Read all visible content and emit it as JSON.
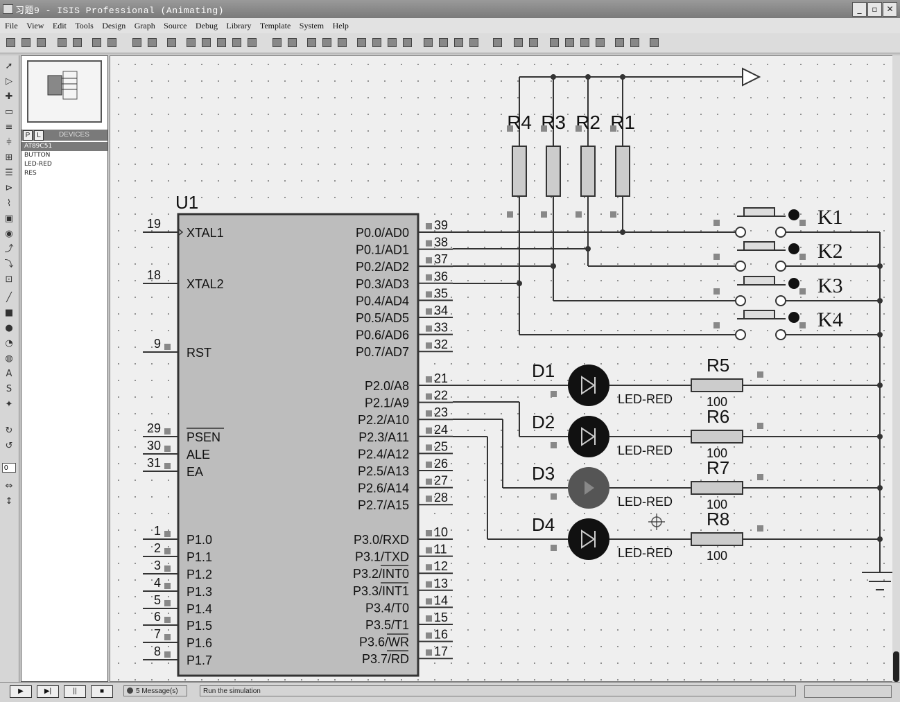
{
  "window": {
    "title": "习题9 - ISIS Professional (Animating)"
  },
  "menu": [
    "File",
    "View",
    "Edit",
    "Tools",
    "Design",
    "Graph",
    "Source",
    "Debug",
    "Library",
    "Template",
    "System",
    "Help"
  ],
  "devices": {
    "tabs": [
      "P",
      "L"
    ],
    "header": "DEVICES",
    "items": [
      "AT89C51",
      "BUTTON",
      "LED-RED",
      "RES"
    ],
    "selected": "AT89C51"
  },
  "rotation_value": "0",
  "schematic": {
    "chip": {
      "ref": "U1",
      "left_pins": [
        {
          "num": "19",
          "name": "XTAL1"
        },
        {
          "num": "18",
          "name": "XTAL2"
        },
        {
          "num": "9",
          "name": "RST"
        },
        {
          "num": "29",
          "name": "PSEN"
        },
        {
          "num": "30",
          "name": "ALE"
        },
        {
          "num": "31",
          "name": "EA"
        },
        {
          "num": "1",
          "name": "P1.0"
        },
        {
          "num": "2",
          "name": "P1.1"
        },
        {
          "num": "3",
          "name": "P1.2"
        },
        {
          "num": "4",
          "name": "P1.3"
        },
        {
          "num": "5",
          "name": "P1.4"
        },
        {
          "num": "6",
          "name": "P1.5"
        },
        {
          "num": "7",
          "name": "P1.6"
        },
        {
          "num": "8",
          "name": "P1.7"
        }
      ],
      "right_pins": [
        {
          "num": "39",
          "name": "P0.0/AD0"
        },
        {
          "num": "38",
          "name": "P0.1/AD1"
        },
        {
          "num": "37",
          "name": "P0.2/AD2"
        },
        {
          "num": "36",
          "name": "P0.3/AD3"
        },
        {
          "num": "35",
          "name": "P0.4/AD4"
        },
        {
          "num": "34",
          "name": "P0.5/AD5"
        },
        {
          "num": "33",
          "name": "P0.6/AD6"
        },
        {
          "num": "32",
          "name": "P0.7/AD7"
        },
        {
          "num": "21",
          "name": "P2.0/A8"
        },
        {
          "num": "22",
          "name": "P2.1/A9"
        },
        {
          "num": "23",
          "name": "P2.2/A10"
        },
        {
          "num": "24",
          "name": "P2.3/A11"
        },
        {
          "num": "25",
          "name": "P2.4/A12"
        },
        {
          "num": "26",
          "name": "P2.5/A13"
        },
        {
          "num": "27",
          "name": "P2.6/A14"
        },
        {
          "num": "28",
          "name": "P2.7/A15"
        },
        {
          "num": "10",
          "name": "P3.0/RXD"
        },
        {
          "num": "11",
          "name": "P3.1/TXD"
        },
        {
          "num": "12",
          "name": "P3.2/INT0"
        },
        {
          "num": "13",
          "name": "P3.3/INT1"
        },
        {
          "num": "14",
          "name": "P3.4/T0"
        },
        {
          "num": "15",
          "name": "P3.5/T1"
        },
        {
          "num": "16",
          "name": "P3.6/WR"
        },
        {
          "num": "17",
          "name": "P3.7/RD"
        }
      ]
    },
    "pullups": [
      "R4",
      "R3",
      "R2",
      "R1"
    ],
    "buttons": [
      "K1",
      "K2",
      "K3",
      "K4"
    ],
    "leds": [
      {
        "ref": "D1",
        "type": "LED-RED",
        "lit": false
      },
      {
        "ref": "D2",
        "type": "LED-RED",
        "lit": false
      },
      {
        "ref": "D3",
        "type": "LED-RED",
        "lit": true
      },
      {
        "ref": "D4",
        "type": "LED-RED",
        "lit": false
      }
    ],
    "resistors": [
      {
        "ref": "R5",
        "value": "100"
      },
      {
        "ref": "R6",
        "value": "100"
      },
      {
        "ref": "R7",
        "value": "100"
      },
      {
        "ref": "R8",
        "value": "100"
      }
    ]
  },
  "status": {
    "sim_buttons": [
      "▶",
      "▶|",
      "||",
      "■"
    ],
    "messages": "5 Message(s)",
    "text": "Run the simulation"
  }
}
